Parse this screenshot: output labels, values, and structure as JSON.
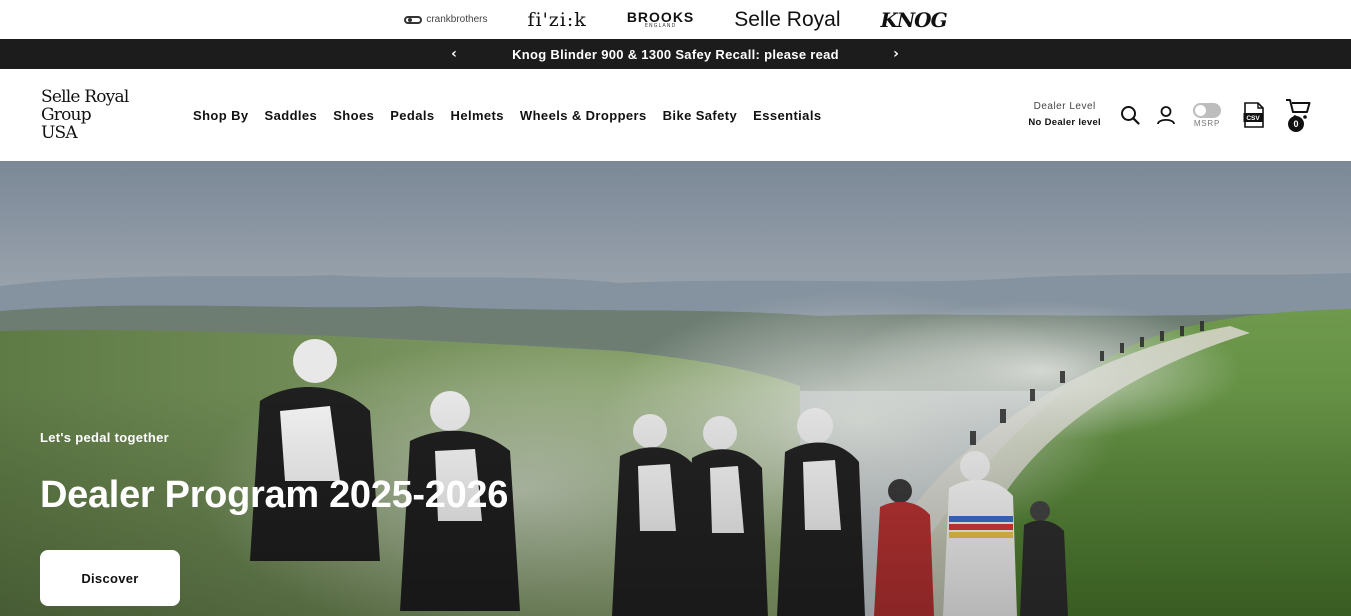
{
  "brands": {
    "crankbrothers": "crankbrothers",
    "fizik": "fi'zi:k",
    "brooks": "BROOKS",
    "brooks_sub": "ENGLAND",
    "selle_royal": "Selle Royal",
    "knog": "KNOG"
  },
  "announcement": {
    "message": "Knog Blinder 900 & 1300 Safey Recall: please read",
    "prev": "‹",
    "next": "›"
  },
  "header": {
    "logo_line1": "Selle Royal Group",
    "logo_line2": "USA",
    "nav": [
      "Shop By",
      "Saddles",
      "Shoes",
      "Pedals",
      "Helmets",
      "Wheels & Droppers",
      "Bike Safety",
      "Essentials"
    ],
    "dealer_label": "Dealer Level",
    "dealer_value": "No Dealer level",
    "msrp_label": "MSRP",
    "msrp_on": false,
    "csv_label": "CSV",
    "cart_count": "0"
  },
  "hero": {
    "eyebrow": "Let's pedal together",
    "title": "Dealer Program 2025-2026",
    "cta": "Discover"
  },
  "colors": {
    "announce_bg": "#1c1c1c",
    "toggle_off": "#bdbdbd",
    "text": "#111111"
  },
  "icons": {
    "search": "search-icon",
    "account": "user-icon",
    "csv": "csv-file-icon",
    "cart": "cart-icon"
  }
}
